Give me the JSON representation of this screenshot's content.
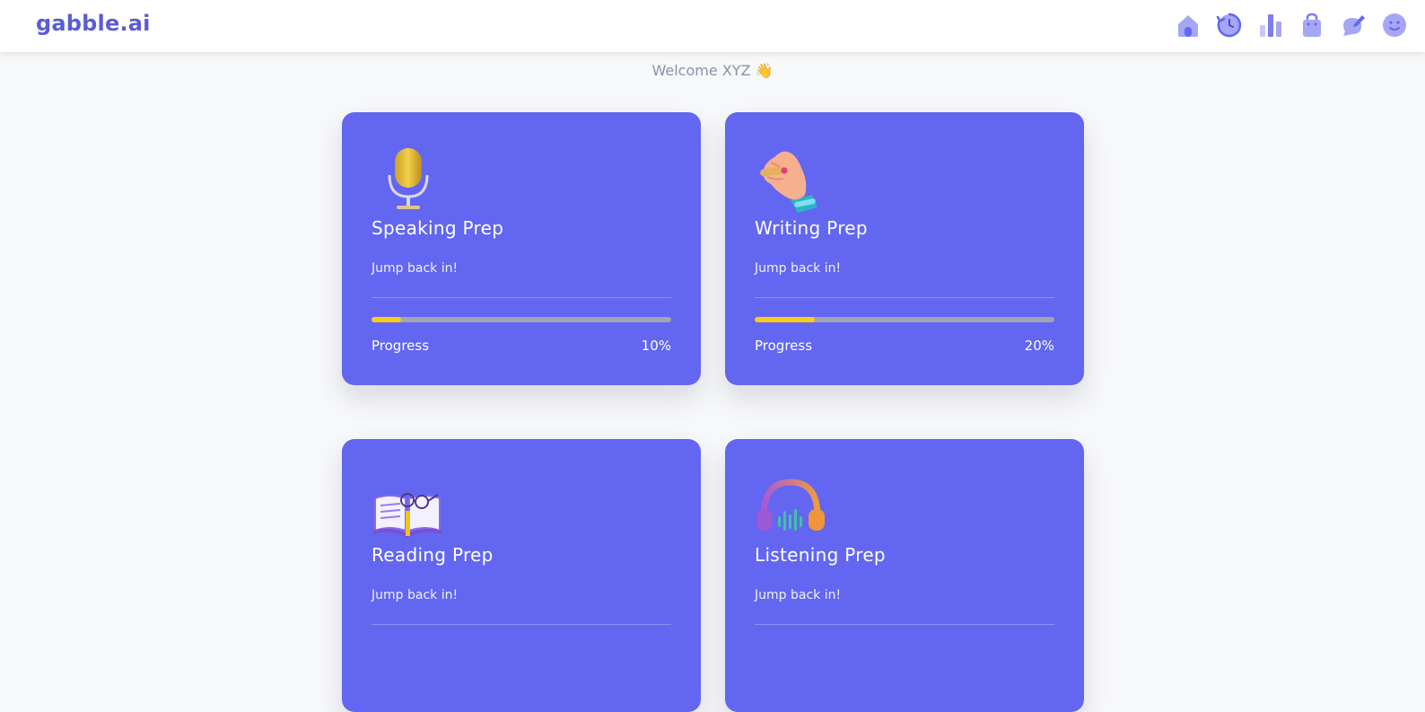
{
  "app": {
    "brand": "gabble.ai",
    "accent_color": "#6366f1",
    "brand_color": "#5b5bd6",
    "icon_color": "#8b8cf3"
  },
  "nav": {
    "icons": [
      "home-icon",
      "history-icon",
      "chart-icon",
      "bag-icon",
      "chat-edit-icon",
      "profile-icon"
    ]
  },
  "welcome": {
    "text": "Welcome XYZ",
    "emoji": "👋"
  },
  "cards": [
    {
      "title": "Speaking Prep",
      "subtitle": "Jump back in!",
      "progress_label": "Progress",
      "progress_text": "10%",
      "progress_value": 0.1,
      "icon": "microphone-icon"
    },
    {
      "title": "Writing Prep",
      "subtitle": "Jump back in!",
      "progress_label": "Progress",
      "progress_text": "20%",
      "progress_value": 0.2,
      "icon": "writing-hand-icon"
    },
    {
      "title": "Reading Prep",
      "subtitle": "Jump back in!",
      "icon": "open-book-icon"
    },
    {
      "title": "Listening Prep",
      "subtitle": "Jump back in!",
      "icon": "headphones-icon"
    }
  ]
}
